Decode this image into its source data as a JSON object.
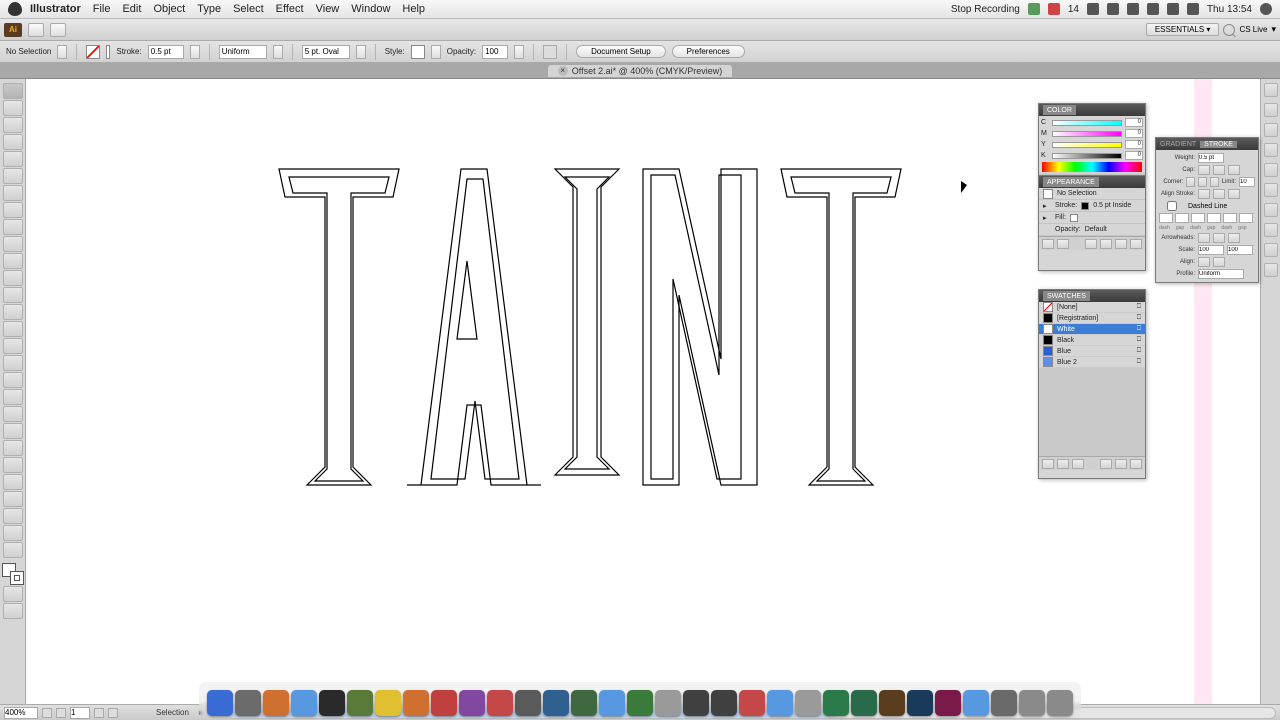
{
  "menubar": {
    "app": "Illustrator",
    "items": [
      "File",
      "Edit",
      "Object",
      "Type",
      "Select",
      "Effect",
      "View",
      "Window",
      "Help"
    ],
    "stop_recording": "Stop Recording",
    "battery": "14",
    "day": "Thu",
    "time": "13:54"
  },
  "topbar": {
    "ai": "Ai",
    "essentials": "ESSENTIALS",
    "cslive": "CS Live"
  },
  "ctrlbar": {
    "selection": "No Selection",
    "stroke_label": "Stroke:",
    "stroke_val": "0.5 pt",
    "variable": "Uniform",
    "points": "5 pt. Oval",
    "style_label": "Style:",
    "opacity_label": "Opacity:",
    "opacity_val": "100",
    "doc_setup": "Document Setup",
    "prefs": "Preferences"
  },
  "doc": {
    "title": "Offset 2.ai* @ 400% (CMYK/Preview)"
  },
  "canvas": {
    "text": "TAINT"
  },
  "panels": {
    "color": {
      "title": "COLOR",
      "c": "0",
      "m": "0",
      "y": "0",
      "k": "0"
    },
    "appearance": {
      "title": "APPEARANCE",
      "noselection": "No Selection",
      "stroke": "Stroke:",
      "stroke_val": "0.5 pt Inside",
      "fill": "Fill:",
      "opacity_lbl": "Opacity:",
      "opacity_val": "Default"
    },
    "swatches": {
      "title": "SWATCHES",
      "items": [
        {
          "name": "[None]",
          "color": "#ffffff",
          "none": true
        },
        {
          "name": "[Registration]",
          "color": "#000000"
        },
        {
          "name": "White",
          "color": "#ffffff",
          "sel": true
        },
        {
          "name": "Black",
          "color": "#000000"
        },
        {
          "name": "Blue",
          "color": "#2a5fd0"
        },
        {
          "name": "Blue 2",
          "color": "#5c90e8"
        }
      ]
    },
    "stroke": {
      "tabs": [
        "GRADIENT",
        "STROKE"
      ],
      "weight_lbl": "Weight:",
      "weight_val": "0.5 pt",
      "cap_lbl": "Cap:",
      "corner_lbl": "Corner:",
      "limit_lbl": "Limit:",
      "limit_val": "10",
      "align_lbl": "Align Stroke:",
      "dashed": "Dashed Line",
      "dash": "dash",
      "gap": "gap",
      "arrow_lbl": "Arrowheads:",
      "scale_lbl": "Scale:",
      "scale_val": "100",
      "align_arr": "Align:",
      "profile_lbl": "Profile:",
      "profile_val": "Uniform"
    }
  },
  "status": {
    "zoom": "400%",
    "tool": "Selection"
  },
  "dock_colors": [
    "#3a6bd4",
    "#6b6b6b",
    "#d07030",
    "#5898e0",
    "#2a2a2a",
    "#5a7a3a",
    "#e0c030",
    "#d07030",
    "#c04040",
    "#8048a0",
    "#c44848",
    "#5a5a5a",
    "#306090",
    "#406840",
    "#5898e0",
    "#3a7a3a",
    "#9a9a9a",
    "#404040",
    "#404040",
    "#c44848",
    "#5898e0",
    "#9a9a9a",
    "#2a7a4a",
    "#286a4a",
    "#5a3c1e",
    "#1a3a5a",
    "#7a1a4a",
    "#5898e0",
    "#6a6a6a",
    "#8a8a8a",
    "#8a8a8a"
  ]
}
